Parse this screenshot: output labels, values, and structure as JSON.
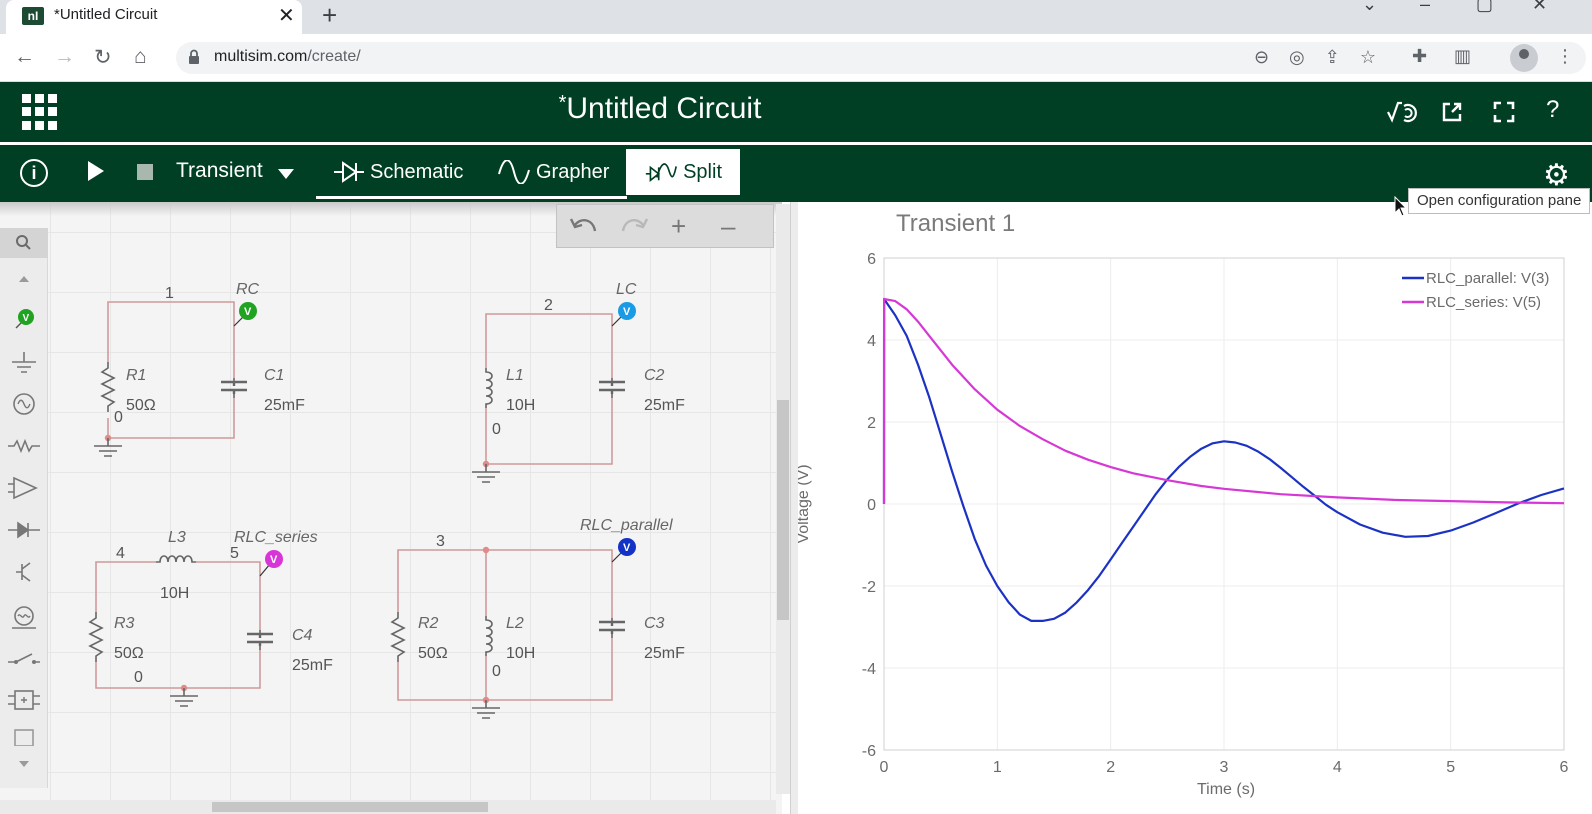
{
  "browser": {
    "tab_title": "*Untitled Circuit",
    "favicon_text": "nI",
    "close_glyph": "✕",
    "newtab_glyph": "+",
    "url_host": "multisim.com",
    "url_path": "/create/"
  },
  "app": {
    "title_marker": "*",
    "title": "Untitled Circuit",
    "header_icons": [
      "measure-icon",
      "share-icon",
      "fullscreen-icon",
      "help-icon"
    ],
    "help_glyph": "?"
  },
  "toolbar": {
    "info_glyph": "i",
    "analysis": "Transient",
    "tabs": [
      {
        "label": "Schematic"
      },
      {
        "label": "Grapher"
      },
      {
        "label": "Split"
      }
    ],
    "tooltip": "Open configuration pane"
  },
  "schematic": {
    "nets": {
      "n1": "1",
      "n2": "2",
      "n3": "3",
      "n4": "4",
      "n5": "5",
      "gnd_a": "0",
      "gnd_b": "0",
      "gnd_c": "0",
      "gnd_d": "0"
    },
    "probes": [
      {
        "name": "RC",
        "color": "#1fa321"
      },
      {
        "name": "LC",
        "color": "#1a9be6"
      },
      {
        "name": "RLC_series",
        "color": "#d835d8"
      },
      {
        "name": "RLC_parallel",
        "color": "#1233c6"
      }
    ],
    "probe_letter": "V",
    "components": {
      "R1": {
        "ref": "R1",
        "value": "50Ω"
      },
      "C1": {
        "ref": "C1",
        "value": "25mF"
      },
      "L1": {
        "ref": "L1",
        "value": "10H"
      },
      "C2": {
        "ref": "C2",
        "value": "25mF"
      },
      "L3": {
        "ref": "L3",
        "value": "10H"
      },
      "R3": {
        "ref": "R3",
        "value": "50Ω"
      },
      "C4": {
        "ref": "C4",
        "value": "25mF"
      },
      "R2": {
        "ref": "R2",
        "value": "50Ω"
      },
      "L2": {
        "ref": "L2",
        "value": "10H"
      },
      "C3": {
        "ref": "C3",
        "value": "25mF"
      }
    },
    "wire_color": "#d09a9a"
  },
  "chart_data": {
    "type": "line",
    "title": "Transient 1",
    "xlabel": "Time (s)",
    "ylabel": "Voltage (V)",
    "xlim": [
      0,
      6
    ],
    "ylim": [
      -6,
      6
    ],
    "xticks": [
      "0",
      "1",
      "2",
      "3",
      "4",
      "5",
      "6"
    ],
    "yticks": [
      "6",
      "4",
      "2",
      "0",
      "-2",
      "-4",
      "-6"
    ],
    "grid": true,
    "legend_position": "top-right",
    "series": [
      {
        "name": "RLC_parallel: V(3)",
        "color": "#1c32c4",
        "x": [
          0,
          0.001,
          0.1,
          0.2,
          0.3,
          0.4,
          0.5,
          0.6,
          0.7,
          0.8,
          0.9,
          1.0,
          1.1,
          1.2,
          1.3,
          1.4,
          1.5,
          1.6,
          1.7,
          1.8,
          1.9,
          2.0,
          2.1,
          2.2,
          2.3,
          2.4,
          2.5,
          2.6,
          2.7,
          2.8,
          2.9,
          3.0,
          3.1,
          3.2,
          3.3,
          3.4,
          3.5,
          3.6,
          3.7,
          3.8,
          3.9,
          4.0,
          4.2,
          4.4,
          4.6,
          4.8,
          5.0,
          5.2,
          5.4,
          5.6,
          5.8,
          6.0
        ],
        "y": [
          0,
          5.0,
          4.6,
          4.1,
          3.4,
          2.6,
          1.7,
          0.8,
          -0.05,
          -0.85,
          -1.5,
          -2.0,
          -2.4,
          -2.7,
          -2.85,
          -2.85,
          -2.8,
          -2.65,
          -2.4,
          -2.1,
          -1.75,
          -1.35,
          -0.95,
          -0.55,
          -0.15,
          0.25,
          0.6,
          0.9,
          1.15,
          1.35,
          1.48,
          1.53,
          1.5,
          1.42,
          1.28,
          1.1,
          0.88,
          0.65,
          0.42,
          0.2,
          -0.02,
          -0.2,
          -0.5,
          -0.7,
          -0.8,
          -0.78,
          -0.65,
          -0.45,
          -0.22,
          0.02,
          0.22,
          0.38
        ]
      },
      {
        "name": "RLC_series: V(5)",
        "color": "#d638d6",
        "x": [
          0,
          0.001,
          0.1,
          0.2,
          0.3,
          0.4,
          0.5,
          0.6,
          0.8,
          1.0,
          1.2,
          1.4,
          1.6,
          1.8,
          2.0,
          2.2,
          2.5,
          2.8,
          3.0,
          3.5,
          4.0,
          4.5,
          5.0,
          5.5,
          6.0
        ],
        "y": [
          0,
          5.0,
          4.95,
          4.75,
          4.45,
          4.1,
          3.75,
          3.4,
          2.8,
          2.3,
          1.9,
          1.58,
          1.3,
          1.08,
          0.9,
          0.75,
          0.58,
          0.44,
          0.37,
          0.24,
          0.16,
          0.1,
          0.07,
          0.04,
          0.02
        ]
      }
    ]
  }
}
